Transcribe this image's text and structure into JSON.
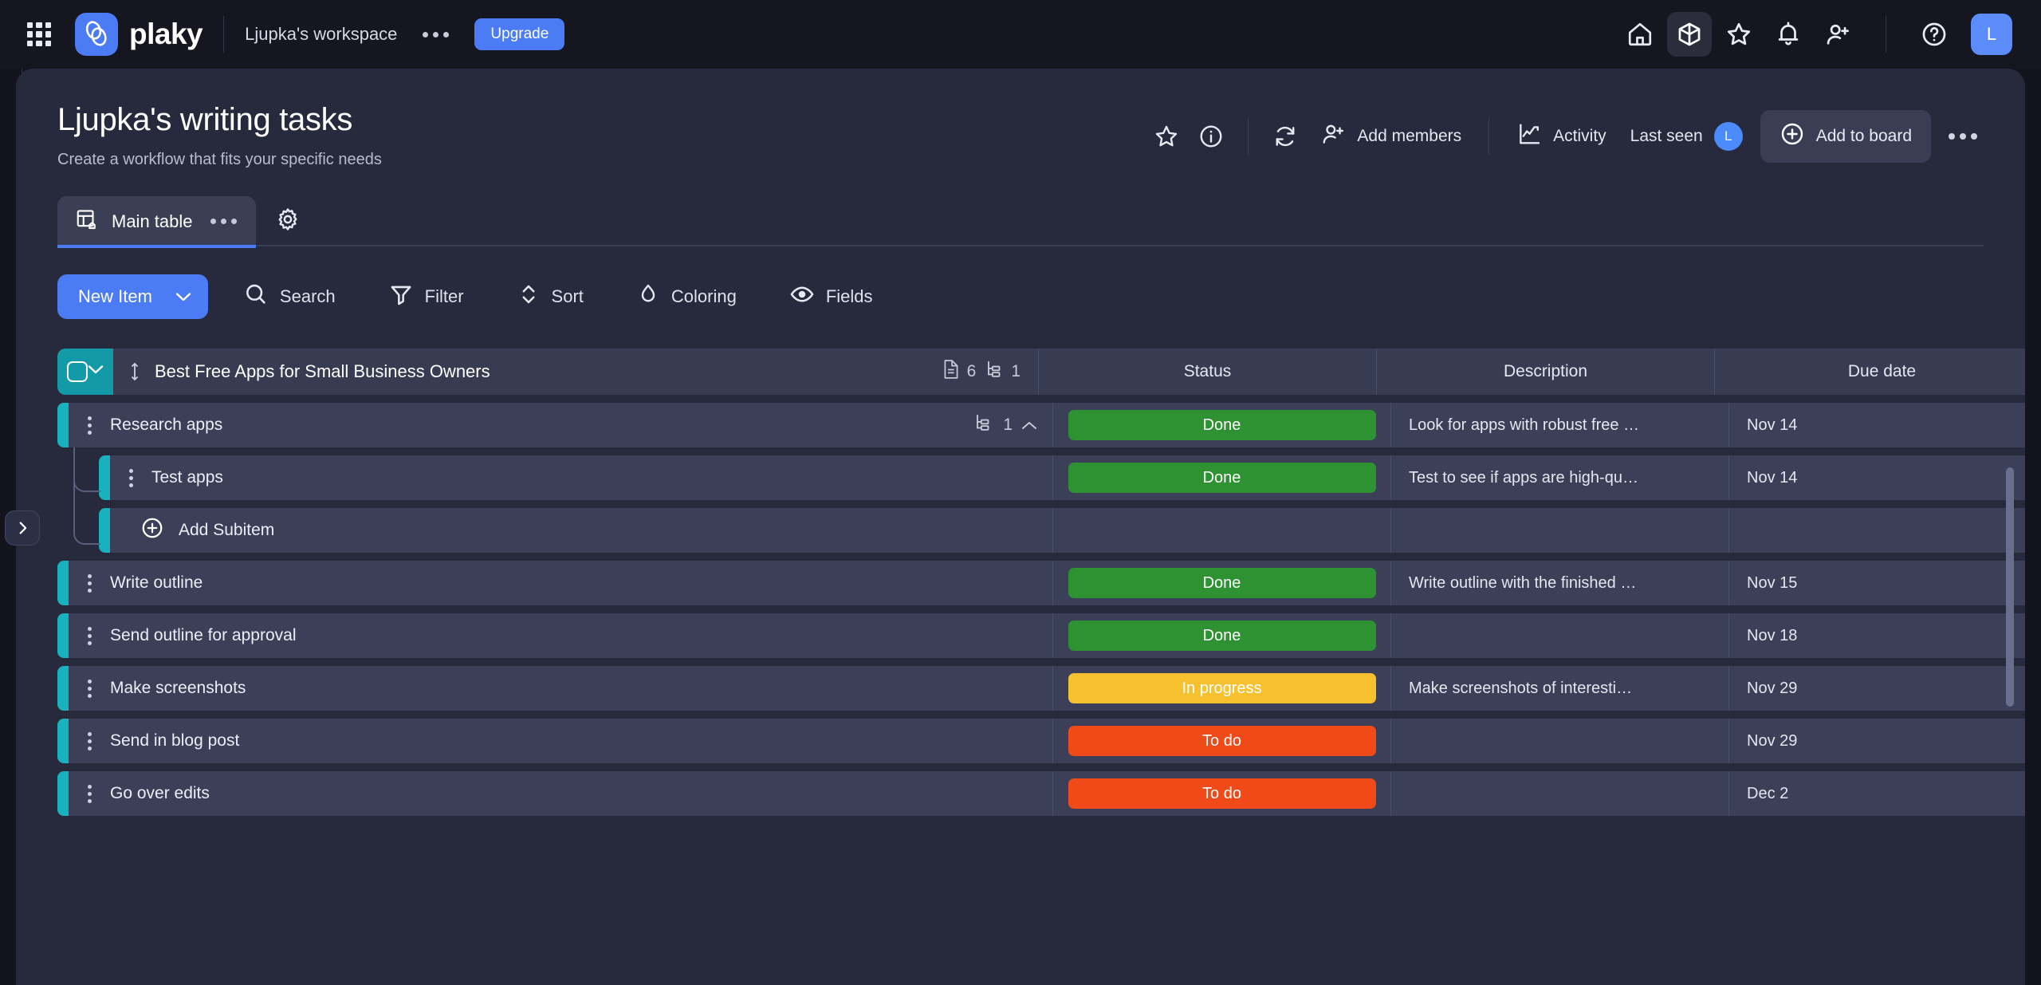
{
  "topnav": {
    "apps_grid_icon": "grid-icon",
    "brand_name": "plaky",
    "workspace_name": "Ljupka's workspace",
    "workspace_more_icon": "ellipsis-icon",
    "upgrade_label": "Upgrade",
    "icons": [
      {
        "name": "home-icon",
        "active": false
      },
      {
        "name": "cube-icon",
        "active": true
      },
      {
        "name": "star-icon",
        "active": false
      },
      {
        "name": "bell-icon",
        "active": false
      },
      {
        "name": "add-user-icon",
        "active": false
      },
      {
        "name": "help-icon",
        "active": false
      }
    ],
    "avatar_initial": "L",
    "accent_color": "#4b7bf5"
  },
  "board": {
    "title": "Ljupka's writing tasks",
    "description": "Create a workflow that fits your specific needs",
    "actions": {
      "favorite_icon": "star-icon",
      "info_icon": "info-icon",
      "refresh_icon": "refresh-icon",
      "add_members_icon": "add-user-icon",
      "add_members_label": "Add members",
      "activity_icon": "activity-chart-icon",
      "activity_label": "Activity",
      "last_seen_label": "Last seen",
      "last_seen_avatar": "L",
      "add_to_board_icon": "plus-circle-icon",
      "add_to_board_label": "Add to board",
      "more_icon": "ellipsis-icon"
    }
  },
  "tabs": {
    "items": [
      {
        "label": "Main table",
        "icon": "table-home-icon",
        "more_icon": "ellipsis-icon",
        "active": true
      }
    ],
    "settings_icon": "gear-icon"
  },
  "toolbar": {
    "new_item_label": "New Item",
    "new_item_caret_icon": "chevron-down-icon",
    "tools": [
      {
        "label": "Search",
        "icon": "search-icon"
      },
      {
        "label": "Filter",
        "icon": "filter-icon"
      },
      {
        "label": "Sort",
        "icon": "sort-updown-icon"
      },
      {
        "label": "Coloring",
        "icon": "droplet-icon"
      },
      {
        "label": "Fields",
        "icon": "eye-icon"
      }
    ]
  },
  "table": {
    "group": {
      "name": "Best Free Apps for Small Business Owners",
      "accent_color": "#139aa8",
      "collapse_icon": "chevron-down-icon",
      "select_all_icon": "checkbox-icon",
      "drag_icon": "drag-handle-icon",
      "doc_count_icon": "document-icon",
      "doc_count": "6",
      "subitem_count_icon": "subitem-icon",
      "subitem_count": "1"
    },
    "columns": [
      {
        "label": "Status"
      },
      {
        "label": "Description"
      },
      {
        "label": "Due date"
      }
    ],
    "add_column_icon": "plus-circle-icon",
    "row_accent_color": "#17b2bd",
    "status_colors": {
      "Done": "#2e9233",
      "In progress": "#f7c02e",
      "To do": "#ef4a18"
    },
    "add_subitem_label": "Add Subitem",
    "add_subitem_icon": "plus-circle-icon",
    "rows": [
      {
        "title": "Research apps",
        "status": "Done",
        "description": "Look for apps with robust free …",
        "due_date": "Nov 14",
        "sub": false,
        "subitem_count": "1",
        "subitem_count_icon": "subitem-icon",
        "collapse_icon": "chevron-up-icon"
      },
      {
        "title": "Test apps",
        "status": "Done",
        "description": "Test to see if apps are high-qu…",
        "due_date": "Nov 14",
        "sub": true
      },
      {
        "title": "Add Subitem",
        "status": "",
        "description": "",
        "due_date": "",
        "sub": true,
        "is_add": true
      },
      {
        "title": "Write outline",
        "status": "Done",
        "description": "Write outline with the finished …",
        "due_date": "Nov 15",
        "sub": false
      },
      {
        "title": "Send outline for approval",
        "status": "Done",
        "description": "",
        "due_date": "Nov 18",
        "sub": false
      },
      {
        "title": "Make screenshots",
        "status": "In progress",
        "description": "Make screenshots of interesti…",
        "due_date": "Nov 29",
        "sub": false
      },
      {
        "title": "Send in blog post",
        "status": "To do",
        "description": "",
        "due_date": "Nov 29",
        "sub": false
      },
      {
        "title": "Go over edits",
        "status": "To do",
        "description": "",
        "due_date": "Dec 2",
        "sub": false
      }
    ]
  },
  "sidebar_toggle_icon": "chevron-right-icon"
}
